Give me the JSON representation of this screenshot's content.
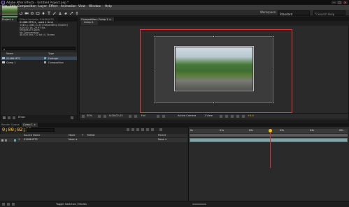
{
  "window": {
    "title": "Adobe After Effects - Untitled Project.aep *",
    "controls": [
      "–",
      "□",
      "×"
    ]
  },
  "menu": {
    "items": [
      "File",
      "Edit",
      "Composition",
      "Layer",
      "Effect",
      "Animation",
      "View",
      "Window",
      "Help"
    ]
  },
  "toolbar": {
    "workspace_label": "Workspace:",
    "workspace_value": "Standard",
    "search_placeholder": "Search Help"
  },
  "project": {
    "tabs": [
      "Project ×",
      "Effect Controls: 01466.MTS"
    ],
    "file_name": "01466.MTS ▾ , used 1 time",
    "meta_lines": [
      "1440 x 1080 (1.33) (Separating (Upper))",
      "0;00;01;16, 29.97 fps",
      "Millions of Colors",
      "No Compression",
      "48.000 kHz / 32 bit U / Stereo"
    ],
    "search_value": "ρ",
    "columns": {
      "name": "Name",
      "type": "Type"
    },
    "rows": [
      {
        "name": "01466.MTS",
        "type": "Footage",
        "label_color": "#6aa8c8"
      },
      {
        "name": "Comp 1",
        "type": "Composition",
        "label_color": "#a3a3a3"
      }
    ],
    "footer_bpc": "8 bpc"
  },
  "composition": {
    "tab": "Composition: Comp 1 ×",
    "sub_tab": "Comp 1",
    "zoom": "50%",
    "timecode": "0;00;02;15",
    "resolution": "Full",
    "camera": "Active Camera",
    "view": "1 View",
    "exposure": "+0.0"
  },
  "timeline": {
    "tabs": [
      "Render Queue",
      "Comp 1 ×"
    ],
    "timecode": "0;00;02;15",
    "columns": {
      "source_name": "Source Name",
      "mode": "Mode",
      "t": "T",
      "trkmat": "TrkMat",
      "parent": "Parent"
    },
    "layer": {
      "number": "1",
      "name": "01466.MTS",
      "mode": "Norm ▾",
      "parent": "None ▾"
    },
    "ruler_labels": [
      "0s",
      "01s",
      "02s",
      "03s",
      "04s",
      "05s"
    ],
    "footer": "Toggle Switches / Modes"
  }
}
